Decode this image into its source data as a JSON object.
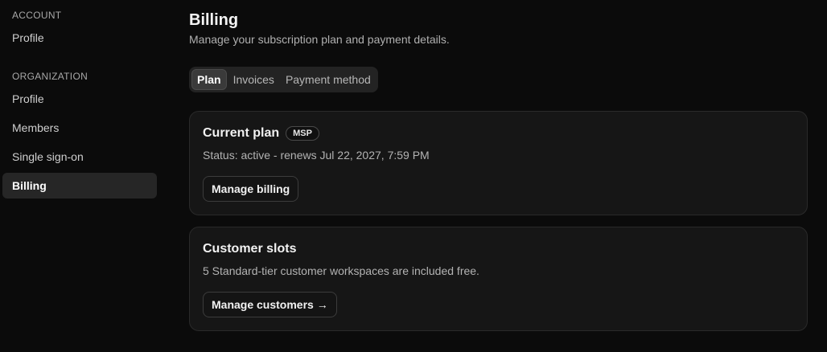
{
  "sidebar": {
    "account_label": "ACCOUNT",
    "account_items": [
      {
        "label": "Profile"
      }
    ],
    "organization_label": "ORGANIZATION",
    "organization_items": [
      {
        "label": "Profile"
      },
      {
        "label": "Members"
      },
      {
        "label": "Single sign-on"
      },
      {
        "label": "Billing",
        "active": true
      }
    ]
  },
  "header": {
    "title": "Billing",
    "subtitle": "Manage your subscription plan and payment details."
  },
  "tabs": [
    {
      "label": "Plan",
      "active": true
    },
    {
      "label": "Invoices"
    },
    {
      "label": "Payment method"
    }
  ],
  "current_plan": {
    "title": "Current plan",
    "badge": "MSP",
    "status": "Status: active - renews Jul 22, 2027, 7:59 PM",
    "button": "Manage billing"
  },
  "customer_slots": {
    "title": "Customer slots",
    "description": "5 Standard-tier customer workspaces are included free.",
    "button": "Manage customers →"
  },
  "colors": {
    "background": "#0b0b0b",
    "card": "#161616",
    "active_nav": "#262626"
  }
}
